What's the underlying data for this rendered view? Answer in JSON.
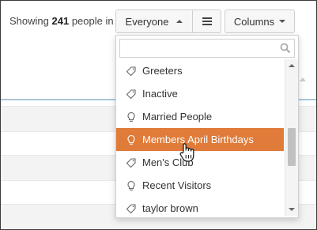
{
  "header": {
    "showing_prefix": "Showing",
    "count": "241",
    "showing_suffix": "people in"
  },
  "filter_button": {
    "label": "Everyone"
  },
  "columns_button": {
    "label": "Columns"
  },
  "dropdown": {
    "search": {
      "value": "",
      "placeholder": ""
    },
    "items": [
      {
        "label": "Greeters",
        "icon": "tag-icon"
      },
      {
        "label": "Inactive",
        "icon": "tag-icon"
      },
      {
        "label": "Married People",
        "icon": "lightbulb-icon"
      },
      {
        "label": "Members April Birthdays",
        "icon": "lightbulb-icon",
        "highlighted": true
      },
      {
        "label": "Men's Club",
        "icon": "tag-icon"
      },
      {
        "label": "Recent Visitors",
        "icon": "lightbulb-icon"
      },
      {
        "label": "taylor brown",
        "icon": "tag-icon"
      }
    ]
  },
  "colors": {
    "highlight": "#e07b3a",
    "table_header_line": "#a9c6da"
  }
}
